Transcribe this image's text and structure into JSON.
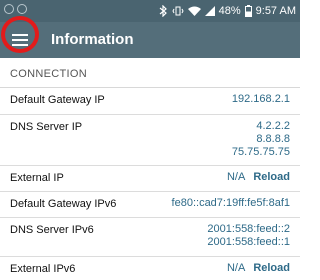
{
  "status_bar": {
    "battery_percent": "48%",
    "time": "9:57 AM"
  },
  "app_bar": {
    "title": "Information"
  },
  "section": {
    "title": "CONNECTION"
  },
  "rows": [
    {
      "label": "Default Gateway IP",
      "values": [
        "192.168.2.1"
      ]
    },
    {
      "label": "DNS Server IP",
      "values": [
        "4.2.2.2",
        "8.8.8.8",
        "75.75.75.75"
      ]
    },
    {
      "label": "External IP",
      "value": "N/A",
      "action": "Reload"
    },
    {
      "label": "Default Gateway IPv6",
      "values": [
        "fe80::cad7:19ff:fe5f:8af1"
      ]
    },
    {
      "label": "DNS Server IPv6",
      "values": [
        "2001:558:feed::2",
        "2001:558:feed::1"
      ]
    },
    {
      "label": "External IPv6",
      "value": "N/A",
      "action": "Reload"
    }
  ],
  "colors": {
    "status_bar": "#4a6470",
    "app_bar": "#546e7a",
    "link": "#2e6a88",
    "highlight_ring": "#e21b1b"
  }
}
